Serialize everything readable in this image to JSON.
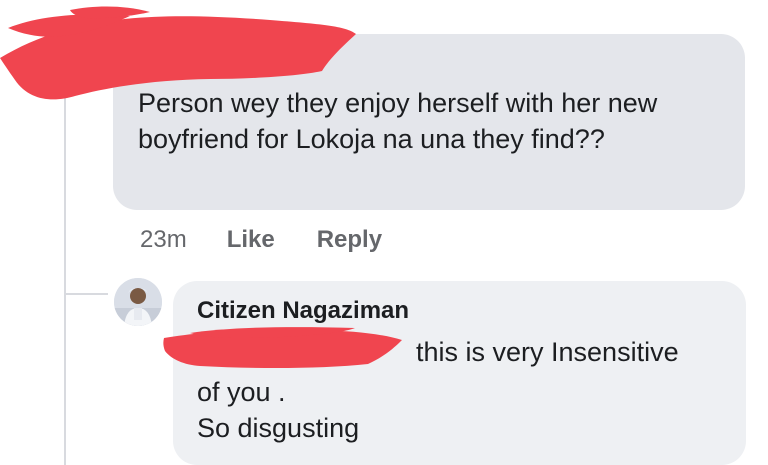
{
  "comment": {
    "text": "Person wey they enjoy herself with her new boyfriend for Lokoja na una they find??",
    "time": "23m",
    "like_label": "Like",
    "reply_label": "Reply"
  },
  "reply": {
    "author": "Citizen Nagaziman",
    "line_1": "this is very Insensitive",
    "line_2": "of you .",
    "line_3": "So disgusting"
  },
  "colors": {
    "bubble": "#e4e6eb",
    "reply_bubble": "#eef0f3",
    "text": "#1c1e21",
    "meta": "#65676b",
    "censor": "#f0454f"
  },
  "icons": {
    "avatar": "user-avatar-icon",
    "censor_top": "redaction-scribble",
    "censor_reply": "redaction-scribble"
  }
}
